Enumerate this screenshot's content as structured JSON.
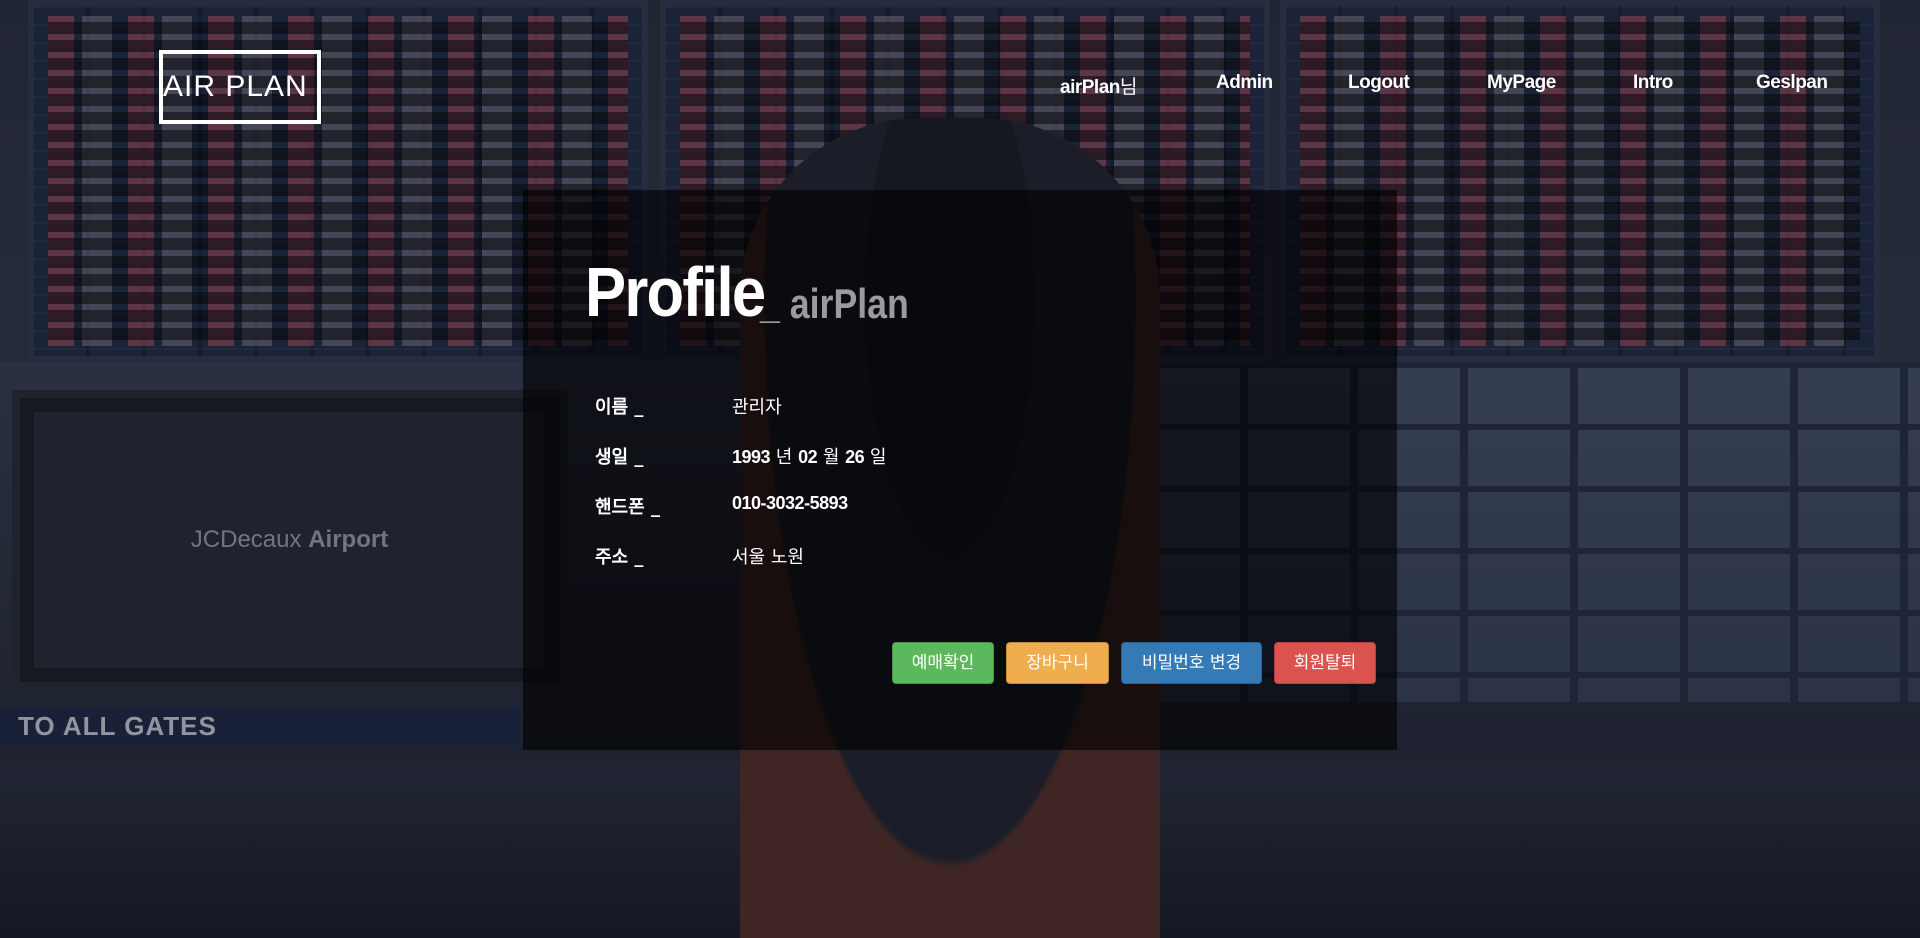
{
  "background": {
    "screen_brand_light": "JCDecaux",
    "screen_brand_bold": "Airport",
    "gate_sign": "TO ALL GATES"
  },
  "header": {
    "logo_text": "AIR PLAN",
    "nav": {
      "user_name": "airPlan",
      "user_suffix": "님",
      "admin": "Admin",
      "logout": "Logout",
      "mypage": "MyPage",
      "intro": "Intro",
      "geslpan": "Geslpan"
    }
  },
  "profile": {
    "title": "Profile",
    "subtitle": "_ airPlan",
    "rows": {
      "name": {
        "label": "이름 _",
        "value": "관리자"
      },
      "birth": {
        "label": "생일 _",
        "year": "1993",
        "year_unit": " 년 ",
        "month": "02",
        "month_unit": " 월 ",
        "day": "26",
        "day_unit": " 일"
      },
      "phone": {
        "label": "핸드폰 _",
        "value": "010-3032-5893"
      },
      "addr": {
        "label": "주소 _",
        "value": "서울 노원"
      }
    },
    "buttons": {
      "reservation": "예매확인",
      "cart": "장바구니",
      "change_password": "비밀번호 변경",
      "withdraw": "회원탈퇴"
    }
  },
  "colors": {
    "btn_green": "#5cb85c",
    "btn_orange": "#f0ad4e",
    "btn_blue": "#337ab7",
    "btn_red": "#d9534f",
    "panel_overlay": "rgba(0,0,0,0.62)"
  }
}
